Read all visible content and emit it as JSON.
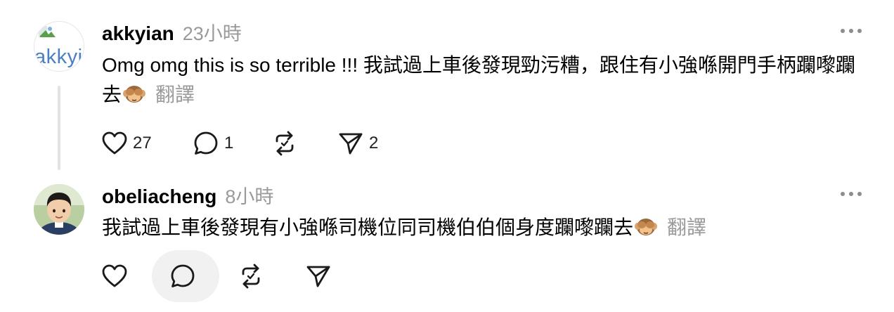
{
  "comments": [
    {
      "username": "akkyian",
      "time": "23小時",
      "avatar_text": "akkyi",
      "text": "Omg omg this is so terrible !!! 我試過上車後發現勁污糟，跟住有小強喺開門手柄躝嚟躝去",
      "translate_label": "翻譯",
      "emoji": "see-no-evil-monkey",
      "likes": "27",
      "replies": "1",
      "reposts": "",
      "shares": "2"
    },
    {
      "username": "obeliacheng",
      "time": "8小時",
      "text": "我試過上車後發現有小強喺司機位同司機伯伯個身度躝嚟躝去",
      "translate_label": "翻譯",
      "emoji": "see-no-evil-monkey",
      "likes": "",
      "replies": "",
      "reposts": "",
      "shares": ""
    }
  ],
  "icons": {
    "like": "heart-icon",
    "reply": "comment-bubble-icon",
    "repost": "repost-icon",
    "share": "send-icon",
    "more": "more-options-icon"
  },
  "colors": {
    "meta_gray": "#9a9a9a",
    "icon": "#1a1a1a",
    "thread_line": "#e3e3e3"
  }
}
